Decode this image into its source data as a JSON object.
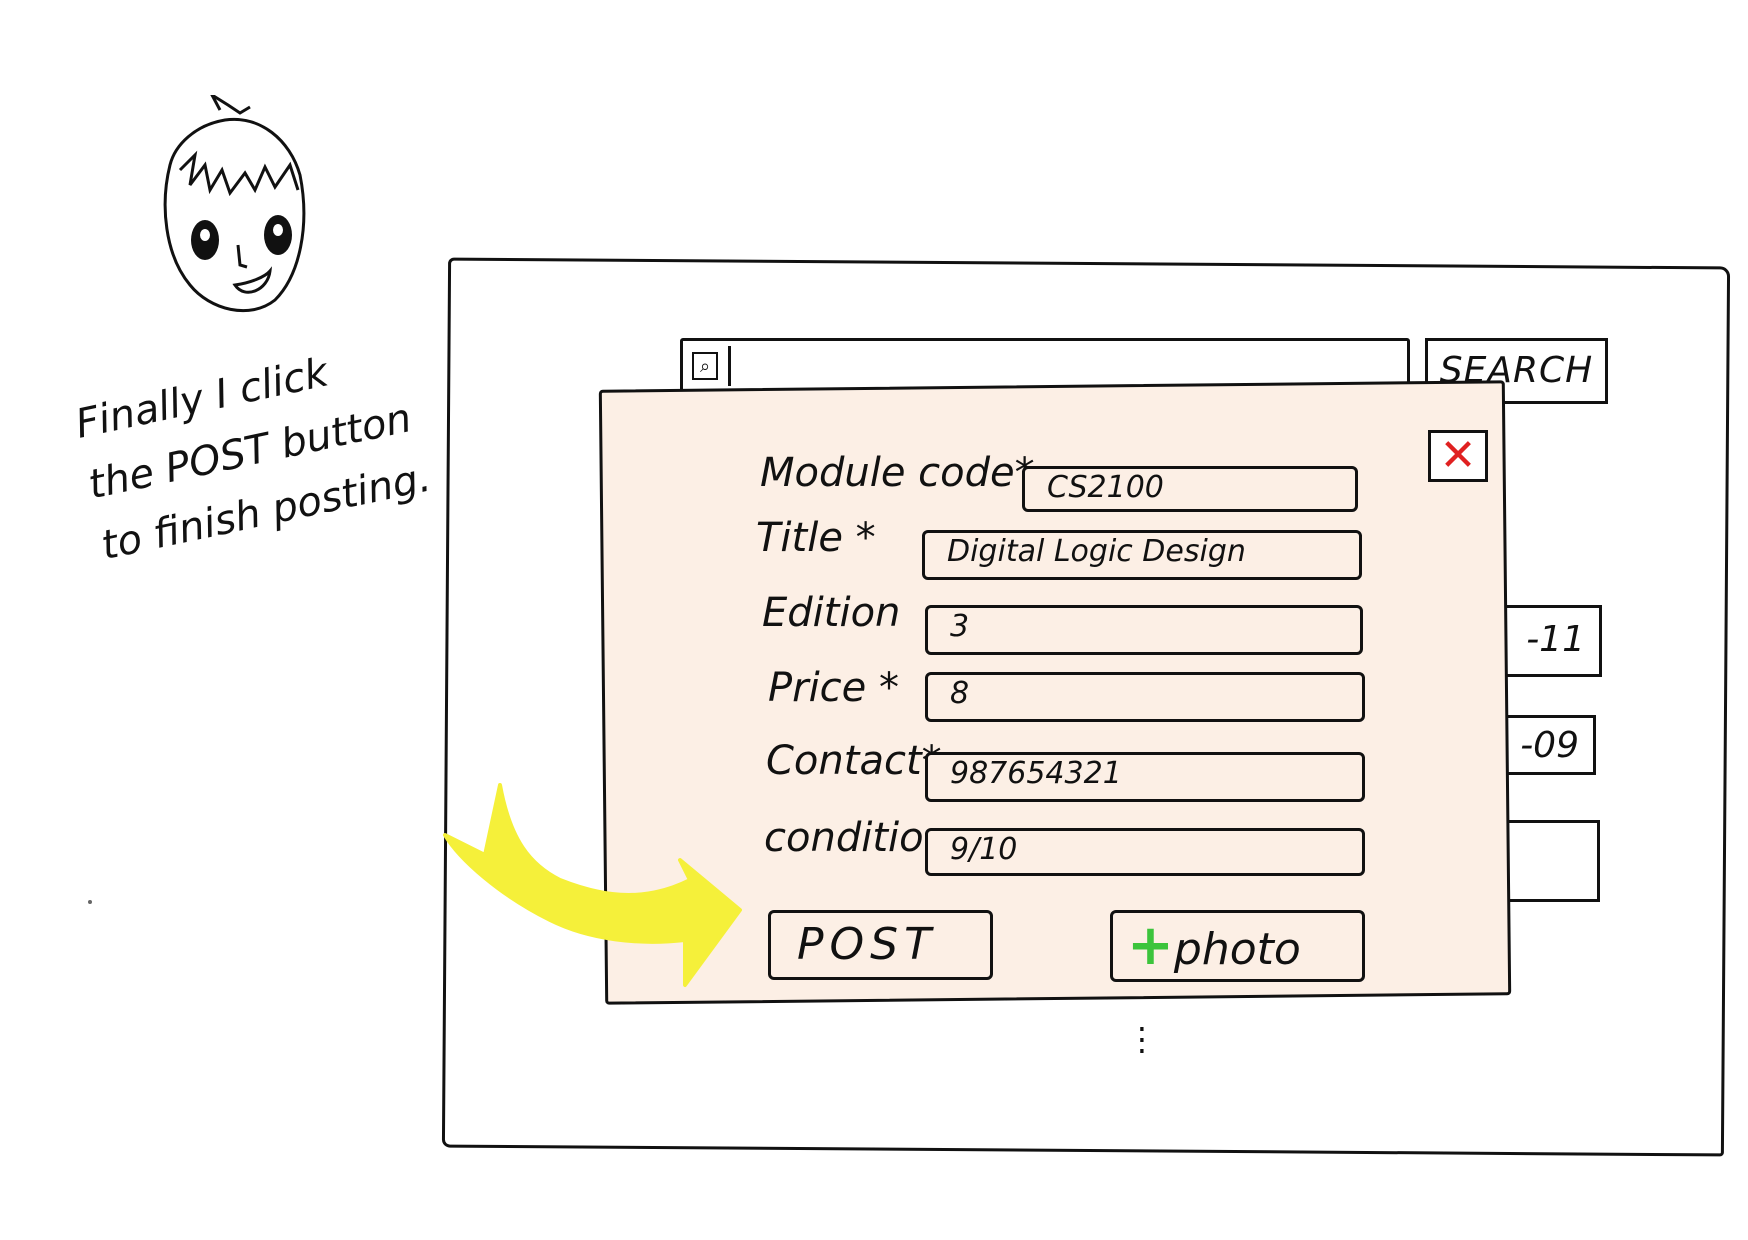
{
  "caption": {
    "lines": [
      "Finally I click",
      "the POST button",
      "to finish posting."
    ]
  },
  "search": {
    "icon": "search-icon",
    "button_label": "SEARCH"
  },
  "background_items": [
    "-11",
    "-09",
    ""
  ],
  "dialog": {
    "close_icon": "close-icon",
    "fields": {
      "module_code": {
        "label": "Module code*",
        "value": "CS2100"
      },
      "title": {
        "label": "Title *",
        "value": "Digital Logic Design"
      },
      "edition": {
        "label": "Edition",
        "value": "3"
      },
      "price": {
        "label": "Price *",
        "value": "8"
      },
      "contact": {
        "label": "Contact*",
        "value": "987654321"
      },
      "condition": {
        "label": "condition",
        "value": "9/10"
      }
    },
    "post_label": "POST",
    "photo_label": "photo",
    "photo_plus": "+"
  },
  "colors": {
    "dialog_bg": "#fcefe5",
    "close_x": "#e02020",
    "plus": "#3cc43c",
    "arrow": "#f5f03a"
  }
}
